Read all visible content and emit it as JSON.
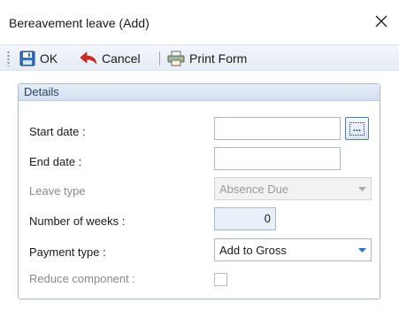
{
  "window": {
    "title": "Bereavement leave (Add)"
  },
  "toolbar": {
    "ok_label": "OK",
    "cancel_label": "Cancel",
    "print_label": "Print Form"
  },
  "panel": {
    "header": "Details",
    "fields": {
      "start_date_label": "Start date :",
      "start_date_value": "",
      "ellipsis_label": "...",
      "end_date_label": "End date :",
      "end_date_value": "",
      "leave_type_label": "Leave type",
      "leave_type_value": "Absence Due",
      "weeks_label": "Number of weeks :",
      "weeks_value": "0",
      "payment_type_label": "Payment type :",
      "payment_type_value": "Add to Gross",
      "reduce_component_label": "Reduce component :"
    }
  },
  "colors": {
    "accent": "#1a5fb4",
    "panel_border": "#a9bcd8"
  }
}
